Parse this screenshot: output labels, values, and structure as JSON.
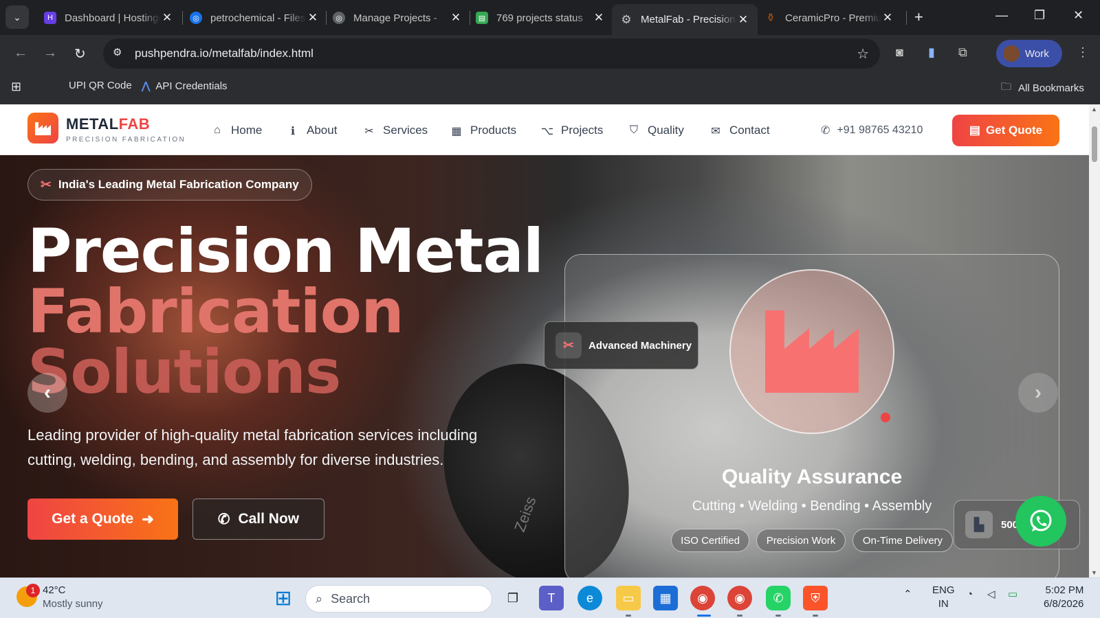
{
  "browser": {
    "tabs": [
      {
        "title": "Dashboard | Hostinger",
        "icon": "hostinger-icon",
        "color": "#673de6"
      },
      {
        "title": "petrochemical - Files",
        "icon": "globe-icon",
        "color": "#1a73e8"
      },
      {
        "title": "Manage Projects - ",
        "icon": "globe-icon",
        "color": "#5f6368"
      },
      {
        "title": "769 projects status",
        "icon": "sheets-icon",
        "color": "#34a853"
      },
      {
        "title": "MetalFab - Precision",
        "icon": "gear-icon",
        "color": "#9aa0a6",
        "active": true
      },
      {
        "title": "CeramicPro - Premium",
        "icon": "vase-icon",
        "color": "#b45309"
      }
    ],
    "url": "pushpendra.io/metalfab/index.html",
    "profile_label": "Work",
    "bookmarks": [
      "UPI QR Code",
      "API Credentials"
    ],
    "all_bookmarks": "All Bookmarks"
  },
  "site": {
    "brand_main": "METAL",
    "brand_accent": "FAB",
    "tagline": "PRECISION FABRICATION",
    "nav": [
      {
        "label": "Home",
        "icon": "home-icon",
        "glyph": "⌂"
      },
      {
        "label": "About",
        "icon": "info-icon",
        "glyph": "ℹ"
      },
      {
        "label": "Services",
        "icon": "tools-icon",
        "glyph": "✂"
      },
      {
        "label": "Products",
        "icon": "box-icon",
        "glyph": "▦"
      },
      {
        "label": "Projects",
        "icon": "diagram-icon",
        "glyph": "⌥"
      },
      {
        "label": "Quality",
        "icon": "shield-icon",
        "glyph": "⛉"
      },
      {
        "label": "Contact",
        "icon": "envelope-icon",
        "glyph": "✉"
      }
    ],
    "phone": "+91 98765 43210",
    "get_quote": "Get Quote",
    "accent_color": "#ef4444",
    "accent_color_2": "#f97316"
  },
  "hero": {
    "badge": "India's Leading Metal Fabrication Company",
    "title_line1": "Precision Metal",
    "title_line2": "Fabrication",
    "title_line3": "Solutions",
    "description": "Leading provider of high-quality metal fabrication services including cutting, welding, bending, and assembly for diverse industries.",
    "cta_quote": "Get a Quote",
    "cta_call": "Call Now",
    "lens_text": "Zeiss",
    "floating_card": "Advanced Machinery",
    "card_title": "Quality Assurance",
    "card_subtitle": "Cutting • Welding • Bending • Assembly",
    "pills": [
      "ISO Certified",
      "Precision Work",
      "On-Time Delivery"
    ],
    "stat_text": "500"
  },
  "taskbar": {
    "weather_temp": "42°C",
    "weather_desc": "Mostly sunny",
    "weather_badge": "1",
    "search_placeholder": "Search",
    "lang_line1": "ENG",
    "lang_line2": "IN",
    "time": "5:02 PM",
    "date": "6/8/2026"
  }
}
